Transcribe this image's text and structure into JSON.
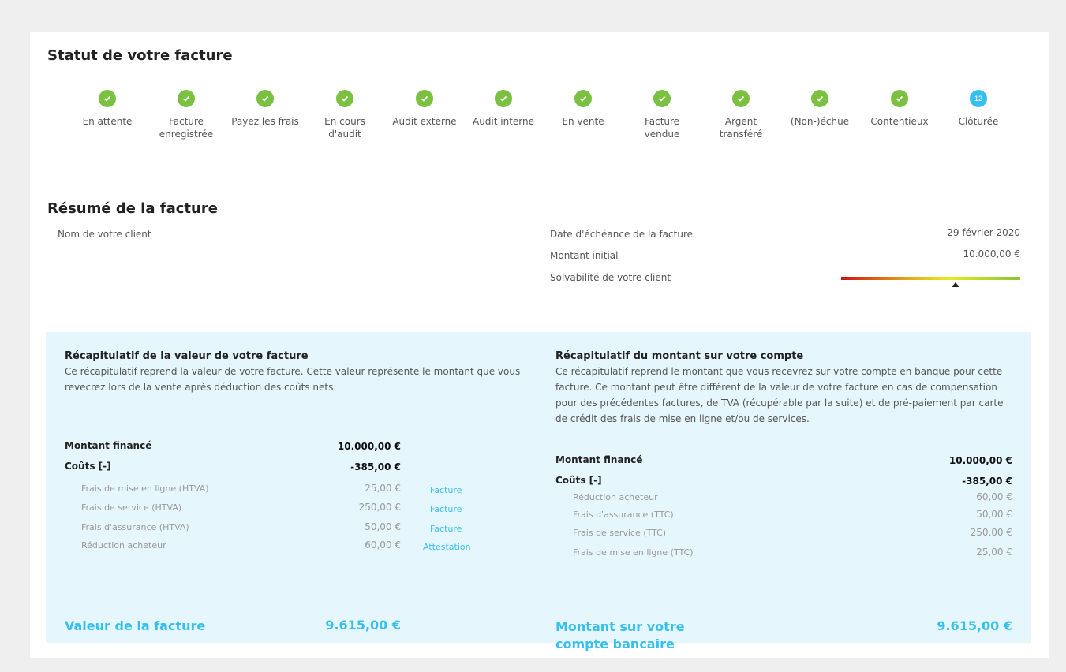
{
  "status": {
    "title": "Statut de votre facture",
    "steps": [
      {
        "label": "En attente",
        "state": "done"
      },
      {
        "label": "Facture enregistrée",
        "state": "done"
      },
      {
        "label": "Payez les frais",
        "state": "done"
      },
      {
        "label": "En cours d'audit",
        "state": "done"
      },
      {
        "label": "Audit externe",
        "state": "done"
      },
      {
        "label": "Audit interne",
        "state": "done"
      },
      {
        "label": "En vente",
        "state": "done"
      },
      {
        "label": "Facture vendue",
        "state": "done"
      },
      {
        "label": "Argent transféré",
        "state": "done"
      },
      {
        "label": "(Non-)échue",
        "state": "done"
      },
      {
        "label": "Contentieux",
        "state": "done"
      },
      {
        "label": "Clôturée",
        "state": "current",
        "badge": "12"
      }
    ],
    "done_color": "#7ac142",
    "current_color": "#36c0ef"
  },
  "summary": {
    "title": "Résumé de la facture",
    "client_label": "Nom de votre client",
    "due_date_label": "Date d'échéance de la facture",
    "due_date_value": "29 février 2020",
    "initial_amount_label": "Montant initial",
    "initial_amount_value": "10.000,00 €",
    "solvency_label": "Solvabilité de votre client",
    "solvency_level": 0.64
  },
  "invoice_value": {
    "title": "Récapitulatif de la valeur de votre facture",
    "description": "Ce récapitulatif reprend la valeur de votre facture. Cette valeur représente le montant que vous revecrez lors de la vente après déduction des coûts nets.",
    "financed_label": "Montant financé",
    "financed_value": "10.000,00 €",
    "costs_label": "Coûts [-]",
    "costs_value": "-385,00 €",
    "cost_items": [
      {
        "label": "Frais de mise en ligne (HTVA)",
        "value": "25,00 €",
        "link": "Facture"
      },
      {
        "label": "Frais de service (HTVA)",
        "value": "250,00 €",
        "link": "Facture"
      },
      {
        "label": "Frais d'assurance (HTVA)",
        "value": "50,00 €",
        "link": "Facture"
      },
      {
        "label": "Réduction acheteur",
        "value": "60,00 €",
        "link": "Attestation"
      }
    ],
    "total_label": "Valeur de la facture",
    "total_value": "9.615,00 €"
  },
  "account_amount": {
    "title": "Récapitulatif du montant sur votre compte",
    "description": "Ce récapitulatif reprend le montant que vous recevrez sur votre compte en banque pour cette facture. Ce montant peut être différent de la valeur de votre facture en cas de compensation pour des précédentes factures, de TVA (récupérable par la suite) et de pré-paiement par carte de crédit des frais de mise en ligne et/ou de services.",
    "financed_label": "Montant financé",
    "financed_value": "10.000,00 €",
    "costs_label": "Coûts [-]",
    "costs_value": "-385,00 €",
    "cost_items": [
      {
        "label": "Réduction acheteur",
        "value": "60,00 €"
      },
      {
        "label": "Frais d'assurance (TTC)",
        "value": "50,00 €"
      },
      {
        "label": "Frais de service (TTC)",
        "value": "250,00 €"
      },
      {
        "label": "Frais de mise en ligne (TTC)",
        "value": "25,00 €"
      }
    ],
    "total_label": "Montant sur votre compte bancaire",
    "total_value": "9.615,00 €"
  },
  "accent_color": "#36c0ef",
  "panel_color": "#e6f6fd"
}
